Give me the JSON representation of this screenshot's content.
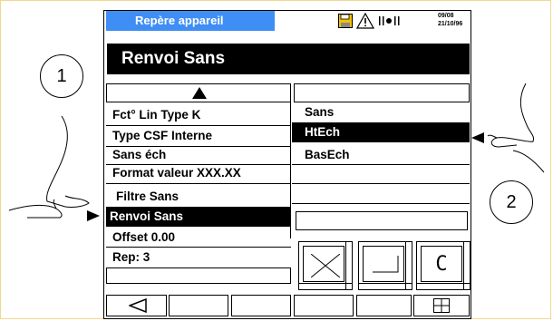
{
  "header": {
    "title": "Repère appareil",
    "date_line1": "09/08",
    "date_line2": "21/10/96",
    "icons": [
      "floppy-icon",
      "warning-icon",
      "signal-icon"
    ]
  },
  "screen_title": "Renvoi  Sans",
  "left_list": {
    "items": [
      {
        "label": "Fct° Lin Type K",
        "selected": false
      },
      {
        "label": "Type CSF Interne",
        "selected": false
      },
      {
        "label": "Sans éch",
        "selected": false
      },
      {
        "label": "Format valeur XXX.XX",
        "selected": false
      },
      {
        "label": "Filtre Sans",
        "selected": false
      },
      {
        "label": "Renvoi Sans",
        "selected": true
      },
      {
        "label": "Offset 0.00",
        "selected": false
      },
      {
        "label": "Rep:  3",
        "selected": false
      }
    ]
  },
  "options": {
    "items": [
      {
        "label": "Sans",
        "selected": false
      },
      {
        "label": "HtEch",
        "selected": true
      },
      {
        "label": "BasEch",
        "selected": false
      }
    ]
  },
  "callouts": {
    "one": "1",
    "two": "2"
  },
  "buttons": {
    "cancel_icon": "x-icon",
    "enter_icon": "enter-icon",
    "clear_glyph": "C"
  },
  "nav": {
    "back_icon": "left-triangle-icon",
    "menu_icon": "grid-icon"
  }
}
